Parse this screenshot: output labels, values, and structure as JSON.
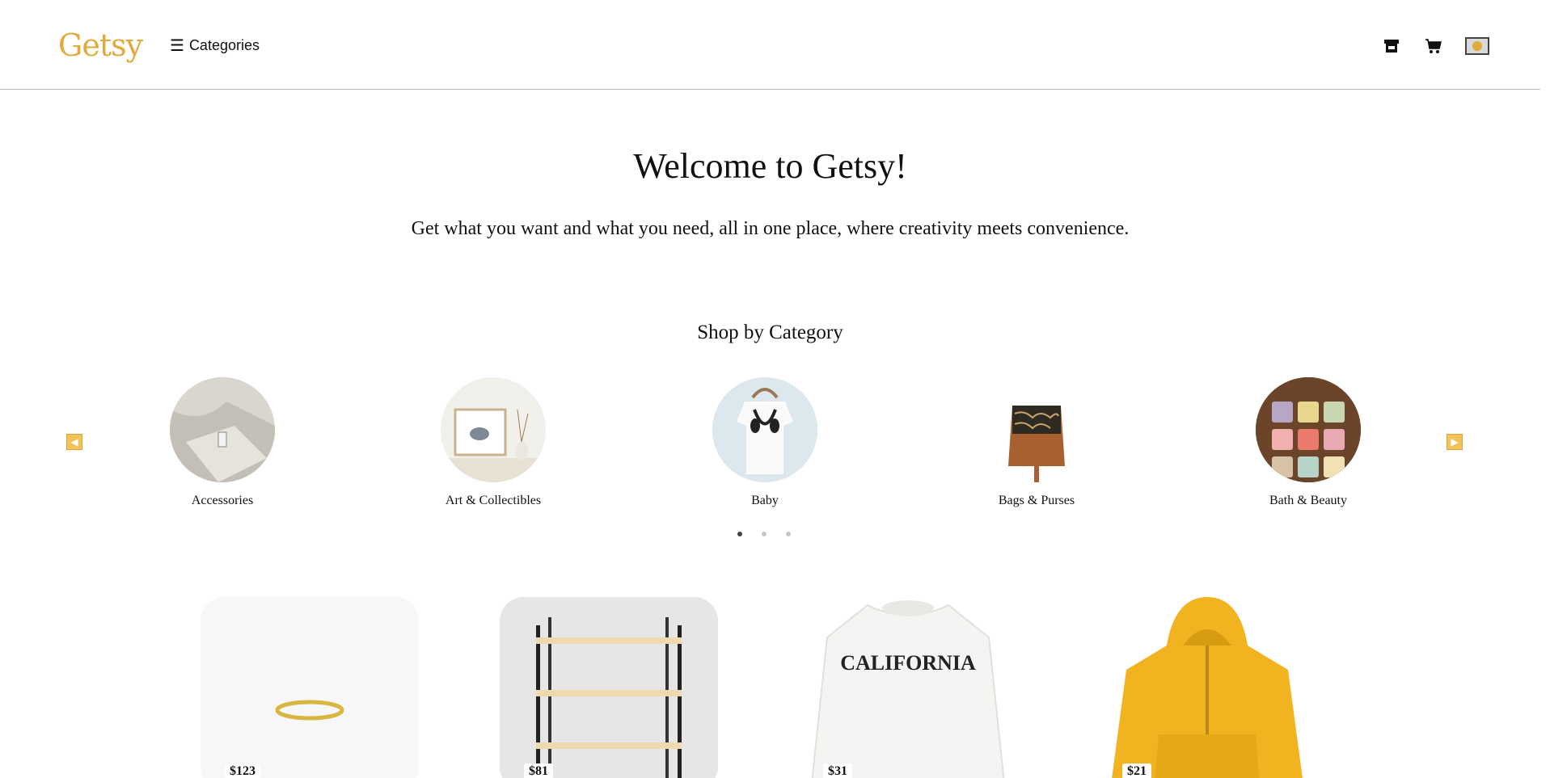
{
  "header": {
    "logo": "Getsy",
    "categories_label": "Categories",
    "icons": [
      "store-icon",
      "cart-icon",
      "user-avatar-icon"
    ]
  },
  "hero": {
    "title": "Welcome to Getsy!",
    "subtitle": "Get what you want and what you need, all in one place, where creativity meets convenience."
  },
  "shop_by_category": {
    "title": "Shop by Category",
    "items": [
      {
        "label": "Accessories"
      },
      {
        "label": "Art & Collectibles"
      },
      {
        "label": "Baby"
      },
      {
        "label": "Bags & Purses"
      },
      {
        "label": "Bath & Beauty"
      }
    ],
    "page_count": 3,
    "active_page": 1
  },
  "products": [
    {
      "price": "$123"
    },
    {
      "price": "$81"
    },
    {
      "price": "$31"
    },
    {
      "price": "$21"
    }
  ],
  "colors": {
    "brand": "#e2a93b",
    "arrow": "#f3c25a"
  }
}
